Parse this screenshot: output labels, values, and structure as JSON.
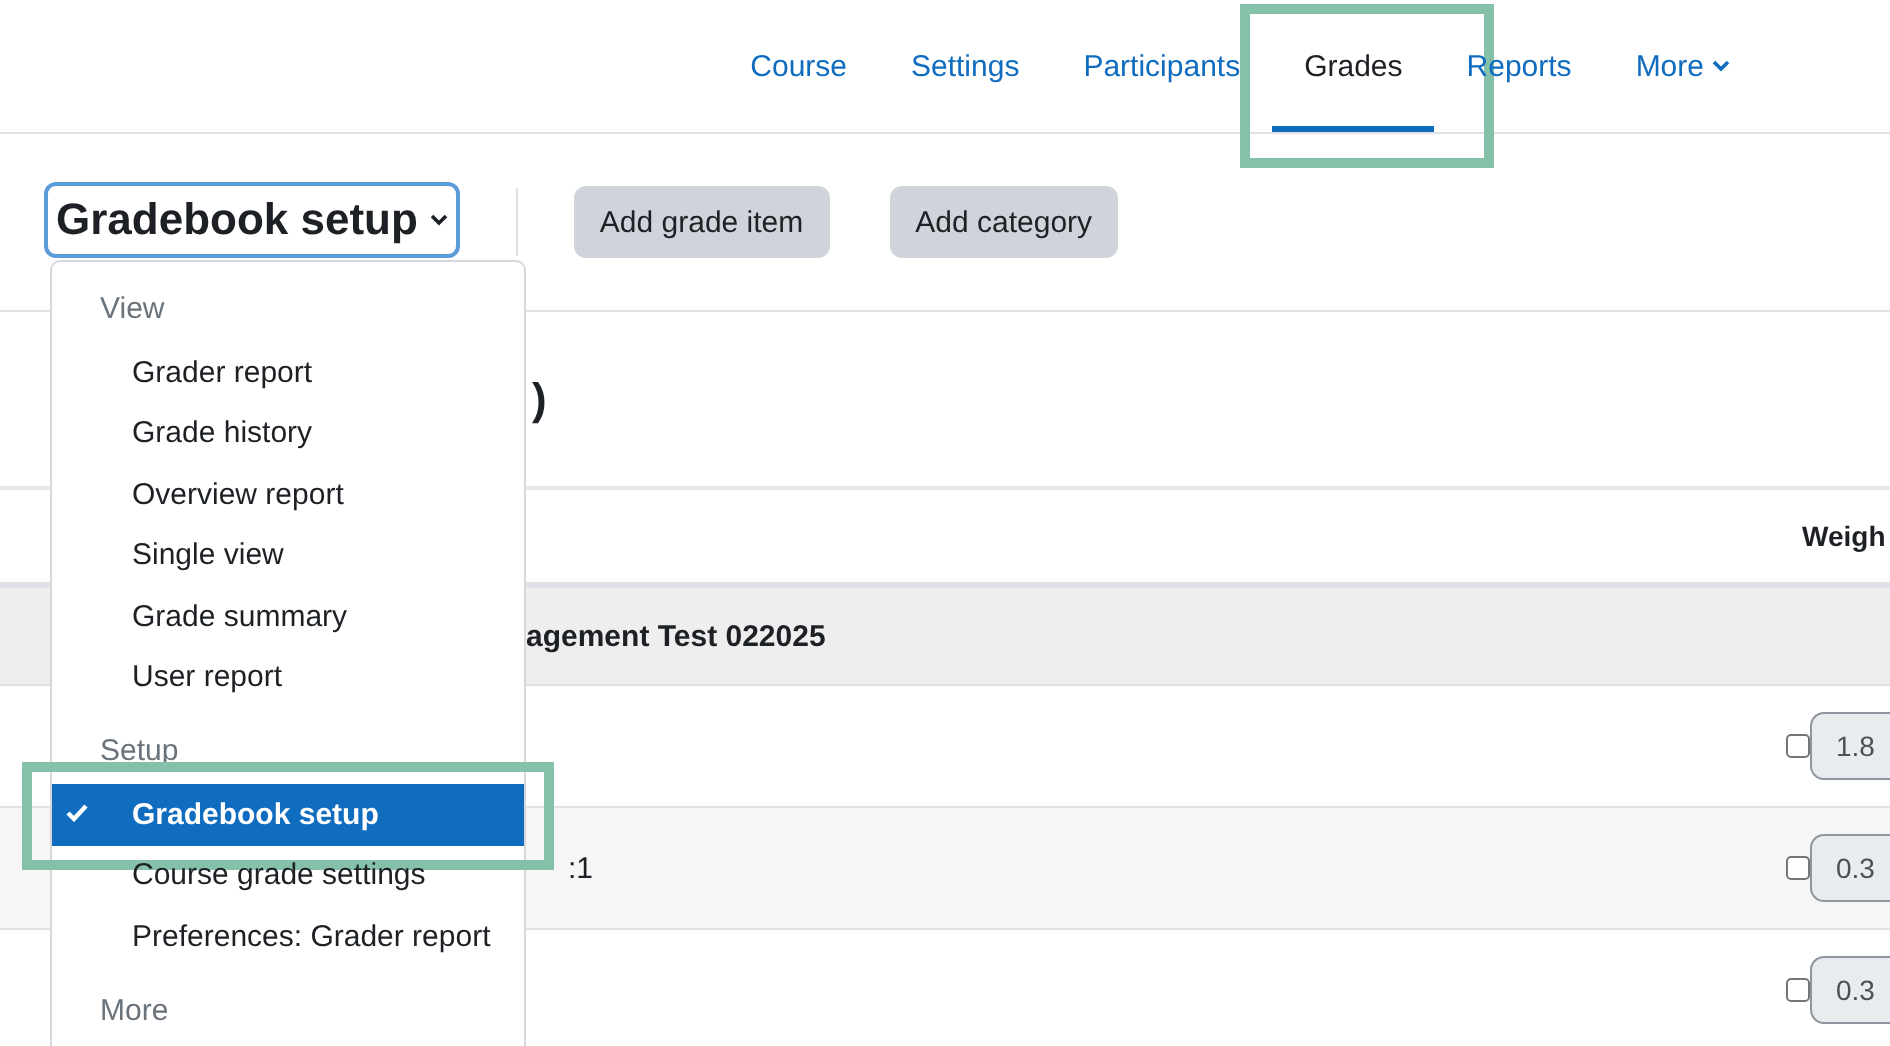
{
  "nav": {
    "tabs": [
      {
        "label": "Course",
        "selected": false,
        "highlighted": false
      },
      {
        "label": "Settings",
        "selected": false,
        "highlighted": false
      },
      {
        "label": "Participants",
        "selected": false,
        "highlighted": false
      },
      {
        "label": "Grades",
        "selected": true,
        "highlighted": true
      },
      {
        "label": "Reports",
        "selected": false,
        "highlighted": false
      },
      {
        "label": "More",
        "selected": false,
        "highlighted": false,
        "kind": "dropdown"
      }
    ]
  },
  "action_bar": {
    "select": {
      "value": "Gradebook setup"
    },
    "buttons": [
      "Add grade item",
      "Add category"
    ]
  },
  "menu": {
    "groups": [
      {
        "label": "View",
        "items": [
          {
            "label": "Grader report",
            "selected": false,
            "highlighted": false
          },
          {
            "label": "Grade history",
            "selected": false,
            "highlighted": false
          },
          {
            "label": "Overview report",
            "selected": false,
            "highlighted": false
          },
          {
            "label": "Single view",
            "selected": false,
            "highlighted": false
          },
          {
            "label": "Grade summary",
            "selected": false,
            "highlighted": false
          },
          {
            "label": "User report",
            "selected": false,
            "highlighted": false
          }
        ]
      },
      {
        "label": "Setup",
        "items": [
          {
            "label": "Gradebook setup",
            "selected": true,
            "highlighted": true
          },
          {
            "label": "Course grade settings",
            "selected": false,
            "highlighted": false
          },
          {
            "label": "Preferences: Grader report",
            "selected": false,
            "highlighted": false
          }
        ]
      },
      {
        "label": "More"
      }
    ]
  },
  "content": {
    "heading": ")",
    "table": {
      "column_header": "Weigh",
      "category": "agement Test 022025",
      "rows": [
        {
          "checked": false,
          "weight": "1.8"
        },
        {
          "name": ":1",
          "checked": false,
          "weight": "0.3"
        },
        {
          "checked": false,
          "weight": "0.3"
        }
      ]
    }
  }
}
